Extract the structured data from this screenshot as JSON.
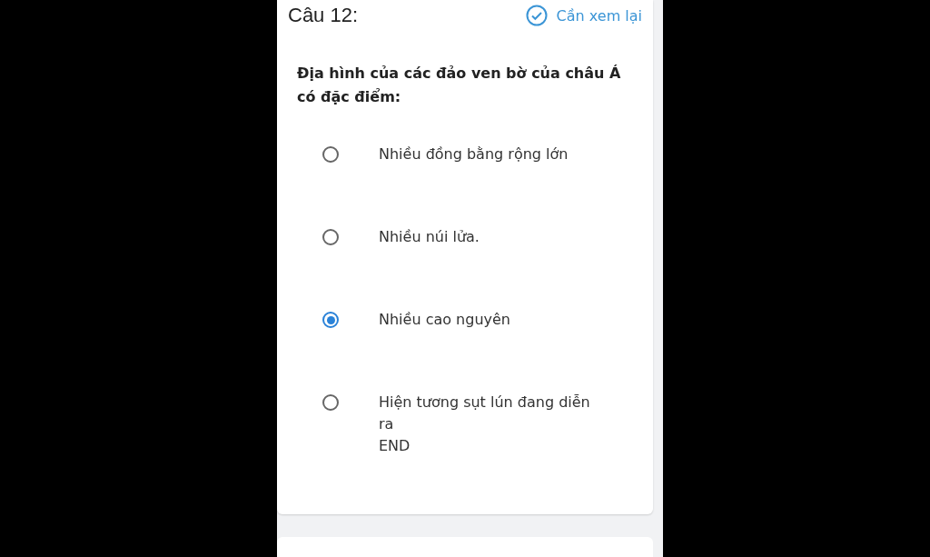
{
  "question": {
    "title": "Câu 12:",
    "review": {
      "label": "Cần xem lại",
      "checked": true
    },
    "text": "Địa hình của các đảo ven bờ của châu Á có đặc điểm:",
    "options": [
      {
        "label": "Nhiều đồng bằng rộng lớn",
        "selected": false
      },
      {
        "label": "Nhiều núi lửa.",
        "selected": false
      },
      {
        "label": "Nhiều cao nguyên",
        "selected": true
      },
      {
        "label": "Hiện tương sụt lún đang diễn ra\nEND",
        "selected": false
      }
    ]
  }
}
